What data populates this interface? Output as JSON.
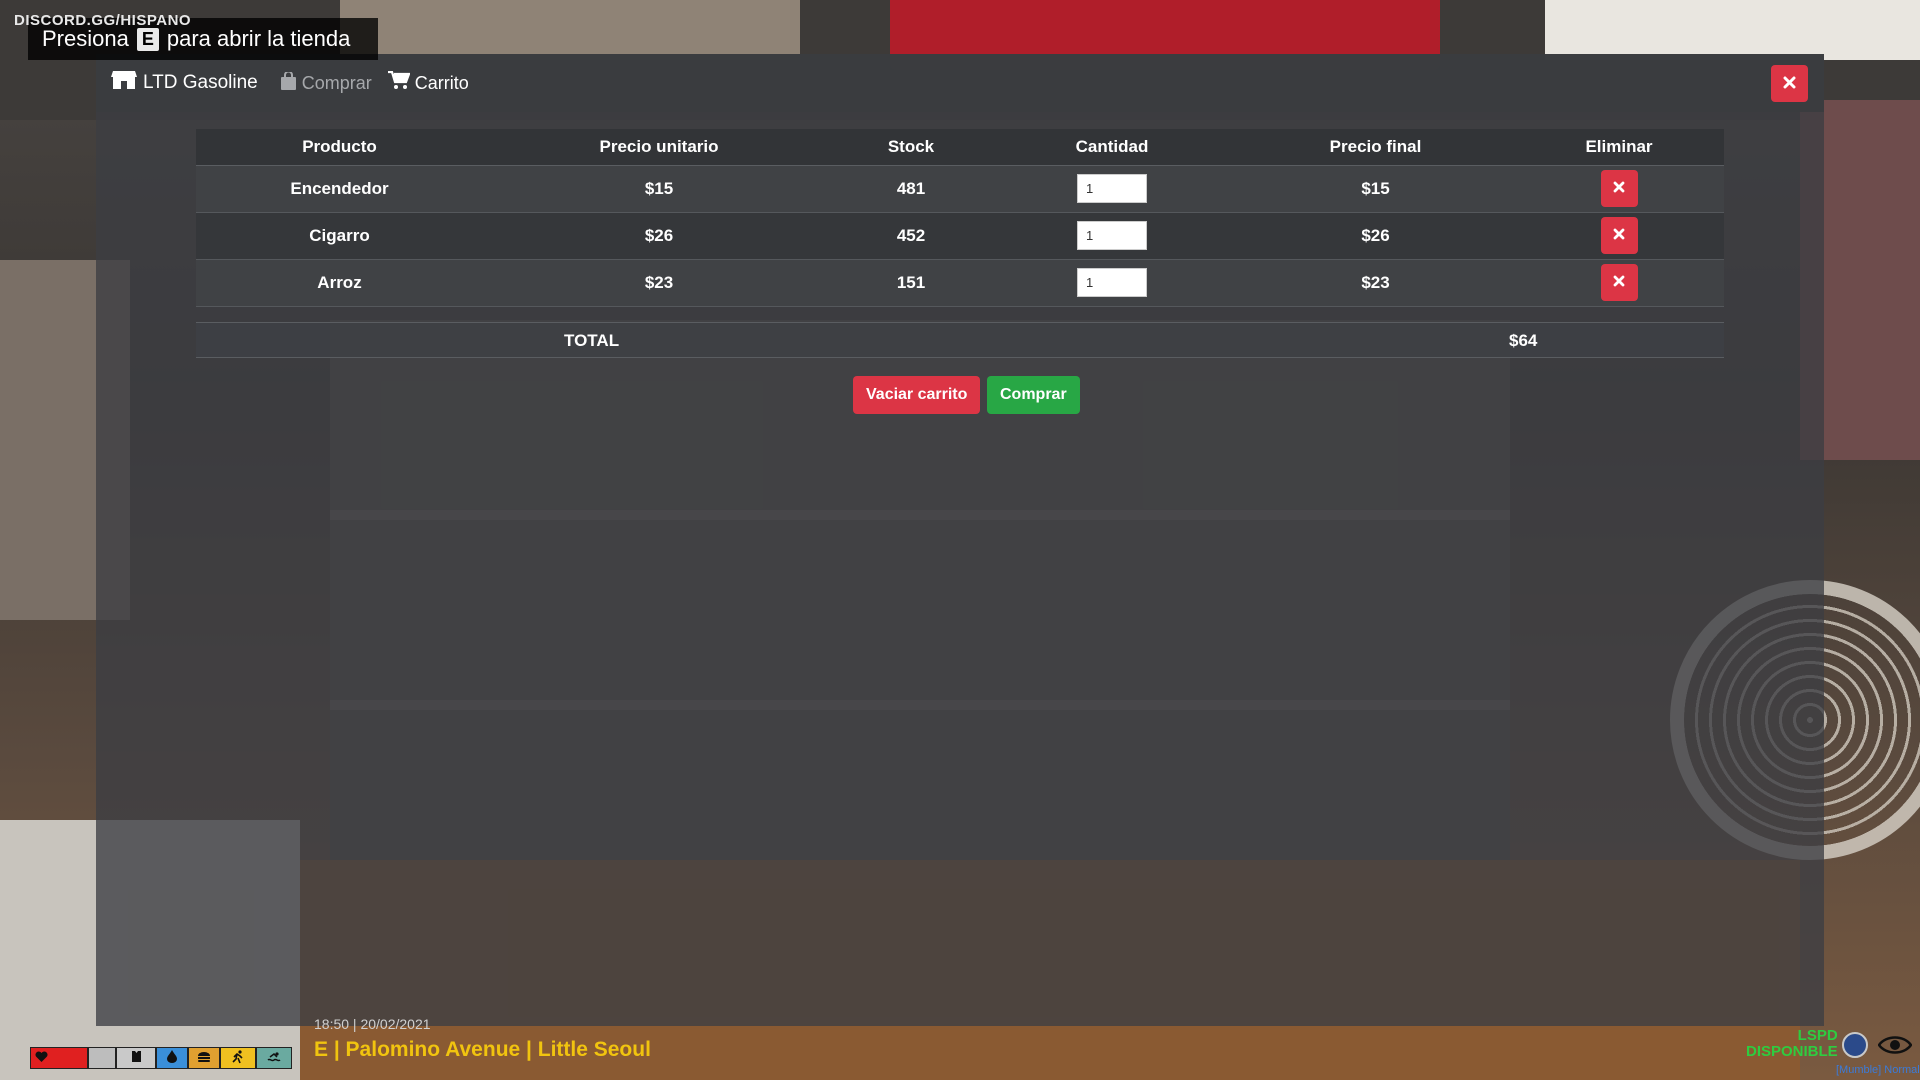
{
  "hint": {
    "discord": "DISCORD.GG/HISPANO",
    "prompt_before": "Presiona",
    "prompt_key": "E",
    "prompt_after": "para abrir la tienda"
  },
  "navbar": {
    "brand": "LTD Gasoline",
    "links": [
      {
        "label": "Comprar",
        "icon": "shopping-bag-icon",
        "state": "muted"
      },
      {
        "label": "Carrito",
        "icon": "cart-icon",
        "state": "active"
      }
    ],
    "close_icon": "close-icon"
  },
  "cart": {
    "headers": [
      "Producto",
      "Precio unitario",
      "Stock",
      "Cantidad",
      "Precio final",
      "Eliminar"
    ],
    "rows": [
      {
        "product": "Encendedor",
        "unit_price": "$15",
        "stock": "481",
        "quantity": "1",
        "final_price": "$15"
      },
      {
        "product": "Cigarro",
        "unit_price": "$26",
        "stock": "452",
        "quantity": "1",
        "final_price": "$26"
      },
      {
        "product": "Arroz",
        "unit_price": "$23",
        "stock": "151",
        "quantity": "1",
        "final_price": "$23"
      }
    ],
    "total_label": "TOTAL",
    "total_value": "$64"
  },
  "actions": {
    "empty_label": "Vaciar carrito",
    "buy_label": "Comprar"
  },
  "hud": {
    "time": "18:50 | 20/02/2021",
    "location": "E | Palomino Avenue | Little Seoul",
    "status_line1": "LSPD",
    "status_line2": "DISPONIBLE",
    "mumble": "[Mumble] Normal"
  },
  "colors": {
    "danger": "#dc3545",
    "success": "#28a745",
    "location_text": "#f1c40f",
    "status_text": "#2ecc40"
  }
}
